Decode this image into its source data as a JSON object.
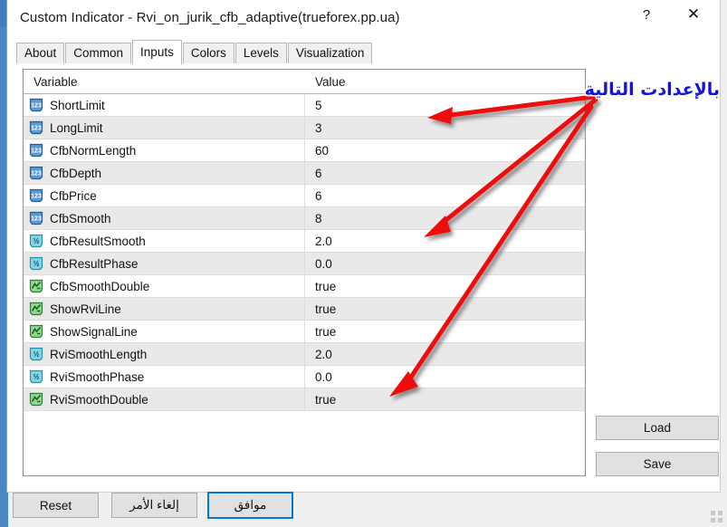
{
  "window": {
    "title": "Custom Indicator - Rvi_on_jurik_cfb_adaptive(trueforex.pp.ua)",
    "help_label": "?",
    "close_label": "✕"
  },
  "tabs": [
    {
      "label": "About",
      "active": false
    },
    {
      "label": "Common",
      "active": false
    },
    {
      "label": "Inputs",
      "active": true
    },
    {
      "label": "Colors",
      "active": false
    },
    {
      "label": "Levels",
      "active": false
    },
    {
      "label": "Visualization",
      "active": false
    }
  ],
  "table": {
    "headers": {
      "variable": "Variable",
      "value": "Value"
    },
    "rows": [
      {
        "icon": "int-123-icon",
        "name": "ShortLimit",
        "value": "5"
      },
      {
        "icon": "int-123-icon",
        "name": "LongLimit",
        "value": "3"
      },
      {
        "icon": "int-123-icon",
        "name": "CfbNormLength",
        "value": "60"
      },
      {
        "icon": "int-123-icon",
        "name": "CfbDepth",
        "value": "6"
      },
      {
        "icon": "int-123-icon",
        "name": "CfbPrice",
        "value": "6"
      },
      {
        "icon": "int-123-icon",
        "name": "CfbSmooth",
        "value": "8"
      },
      {
        "icon": "double-half-icon",
        "name": "CfbResultSmooth",
        "value": "2.0"
      },
      {
        "icon": "double-half-icon",
        "name": "CfbResultPhase",
        "value": "0.0"
      },
      {
        "icon": "bool-chart-icon",
        "name": "CfbSmoothDouble",
        "value": "true"
      },
      {
        "icon": "bool-chart-icon",
        "name": "ShowRviLine",
        "value": "true"
      },
      {
        "icon": "bool-chart-icon",
        "name": "ShowSignalLine",
        "value": "true"
      },
      {
        "icon": "double-half-icon",
        "name": "RviSmoothLength",
        "value": "2.0"
      },
      {
        "icon": "double-half-icon",
        "name": "RviSmoothPhase",
        "value": "0.0"
      },
      {
        "icon": "bool-chart-icon",
        "name": "RviSmoothDouble",
        "value": "true"
      }
    ]
  },
  "side_buttons": {
    "load": "Load",
    "save": "Save"
  },
  "bottom_buttons": {
    "reset": "Reset",
    "cancel": "إلغاء الأمر",
    "ok": "موافق"
  },
  "annotation": {
    "text": "بالإعدادت التالية",
    "color": "#1414d2",
    "arrow_color": "#ee1111"
  }
}
